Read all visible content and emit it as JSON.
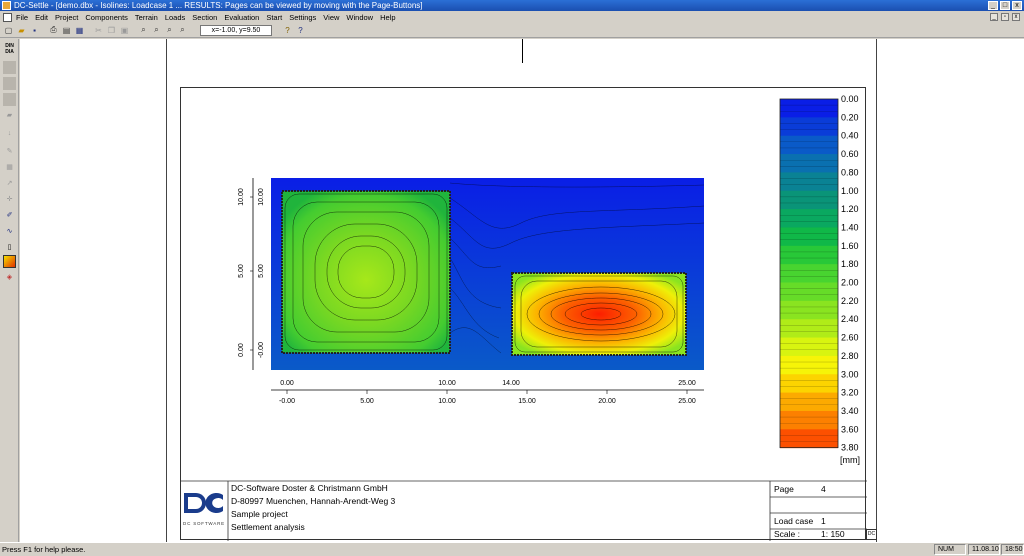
{
  "window": {
    "title": "DC-Settle - [demo.dbx - Isolines: Loadcase 1 ... RESULTS: Pages can be viewed by moving with the Page-Buttons]"
  },
  "menu": [
    "File",
    "Edit",
    "Project",
    "Components",
    "Terrain",
    "Loads",
    "Section",
    "Evaluation",
    "Start",
    "Settings",
    "View",
    "Window",
    "Help"
  ],
  "toolbar": {
    "coordinate_readout": "x=-1.00, y=9.50",
    "icons": [
      "new-icon",
      "open-icon",
      "save-icon",
      "print-icon",
      "print-preview-icon",
      "export-icon",
      "cut-icon",
      "copy-icon",
      "paste-icon",
      "zoom-in-icon",
      "zoom-out-icon",
      "zoom-window-icon",
      "zoom-all-icon",
      "help-icon",
      "context-help-icon"
    ]
  },
  "left_toolbar": {
    "din_label": "DIN\nDIA"
  },
  "plot": {
    "x_ticks_top": [
      "0.00",
      "10.00",
      "14.00",
      "25.00"
    ],
    "x_ticks_bottom": [
      "-0.00",
      "5.00",
      "10.00",
      "15.00",
      "20.00",
      "25.00"
    ],
    "y_ticks": [
      "10.00",
      "5.00",
      "0.00"
    ],
    "y_ticks_inner": [
      "10.00",
      "5.00",
      "-0.00"
    ],
    "colors": {
      "low": "#0a2fd8",
      "high": "#ff1a00"
    }
  },
  "legend": {
    "values": [
      "0.00",
      "0.20",
      "0.40",
      "0.60",
      "0.80",
      "1.00",
      "1.20",
      "1.40",
      "1.60",
      "1.80",
      "2.00",
      "2.20",
      "2.40",
      "2.60",
      "2.80",
      "3.00",
      "3.20",
      "3.40",
      "3.60",
      "3.80"
    ],
    "unit": "[mm]",
    "colors": [
      "#0a1ee6",
      "#0a3cd8",
      "#0a5ac8",
      "#0a70b0",
      "#0a8294",
      "#0a9478",
      "#0aa860",
      "#10b848",
      "#28c838",
      "#48d430",
      "#66dc28",
      "#8ae420",
      "#b0ec18",
      "#d8f410",
      "#f6f408",
      "#fcd400",
      "#fcaa00",
      "#fc8000",
      "#fc5000",
      "#fc1e00"
    ]
  },
  "title_block": {
    "company": "DC-Software Doster & Christmann GmbH",
    "address": "D-80997 Muenchen, Hannah-Arendt-Weg 3",
    "project": "Sample project",
    "subject": "Settlement analysis",
    "logo_text": "DC SOFTWARE",
    "page_label": "Page",
    "page_value": "4",
    "loadcase_label": "Load case",
    "loadcase_value": "1",
    "scale_label": "Scale   :",
    "scale_value": "1: 150",
    "corner_badge": "DC"
  },
  "status": {
    "help": "Press F1 for help please.",
    "num": "NUM",
    "date": "11.08.10",
    "time": "18:50"
  }
}
